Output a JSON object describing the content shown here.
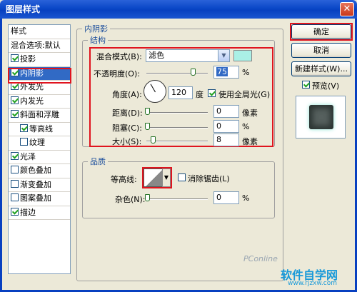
{
  "window": {
    "title": "图层样式",
    "close_glyph": "✕"
  },
  "sidebar": {
    "header": "样式",
    "blend_options": "混合选项:默认",
    "items": [
      {
        "label": "投影",
        "checked": true,
        "indent": false,
        "selected": false
      },
      {
        "label": "内阴影",
        "checked": true,
        "indent": false,
        "selected": true
      },
      {
        "label": "外发光",
        "checked": true,
        "indent": false,
        "selected": false
      },
      {
        "label": "内发光",
        "checked": true,
        "indent": false,
        "selected": false
      },
      {
        "label": "斜面和浮雕",
        "checked": true,
        "indent": false,
        "selected": false
      },
      {
        "label": "等高线",
        "checked": true,
        "indent": true,
        "selected": false
      },
      {
        "label": "纹理",
        "checked": false,
        "indent": true,
        "selected": false
      },
      {
        "label": "光泽",
        "checked": true,
        "indent": false,
        "selected": false
      },
      {
        "label": "颜色叠加",
        "checked": false,
        "indent": false,
        "selected": false
      },
      {
        "label": "渐变叠加",
        "checked": false,
        "indent": false,
        "selected": false
      },
      {
        "label": "图案叠加",
        "checked": false,
        "indent": false,
        "selected": false
      },
      {
        "label": "描边",
        "checked": true,
        "indent": false,
        "selected": false
      }
    ]
  },
  "panel": {
    "title": "内阴影",
    "structure": {
      "title": "结构",
      "blend_mode_label": "混合模式(B):",
      "blend_mode_value": "滤色",
      "swatch_color": "#aaf0e6",
      "opacity_label": "不透明度(O):",
      "opacity_value": "75",
      "opacity_unit": "%",
      "angle_label": "角度(A):",
      "angle_value": "120",
      "angle_unit": "度",
      "global_light_label": "使用全局光(G)",
      "global_light_checked": true,
      "distance_label": "距离(D):",
      "distance_value": "0",
      "distance_unit": "像素",
      "choke_label": "阻塞(C):",
      "choke_value": "0",
      "choke_unit": "%",
      "size_label": "大小(S):",
      "size_value": "8",
      "size_unit": "像素"
    },
    "quality": {
      "title": "品质",
      "contour_label": "等高线:",
      "antialias_label": "消除锯齿(L)",
      "antialias_checked": false,
      "noise_label": "杂色(N):",
      "noise_value": "0",
      "noise_unit": "%"
    }
  },
  "buttons": {
    "ok": "确定",
    "cancel": "取消",
    "new_style": "新建样式(W)...",
    "preview_label": "预览(V)",
    "preview_checked": true
  },
  "watermark": {
    "site_name": "软件自学网",
    "url": "www.rjzxw.com",
    "brand": "PConline"
  }
}
